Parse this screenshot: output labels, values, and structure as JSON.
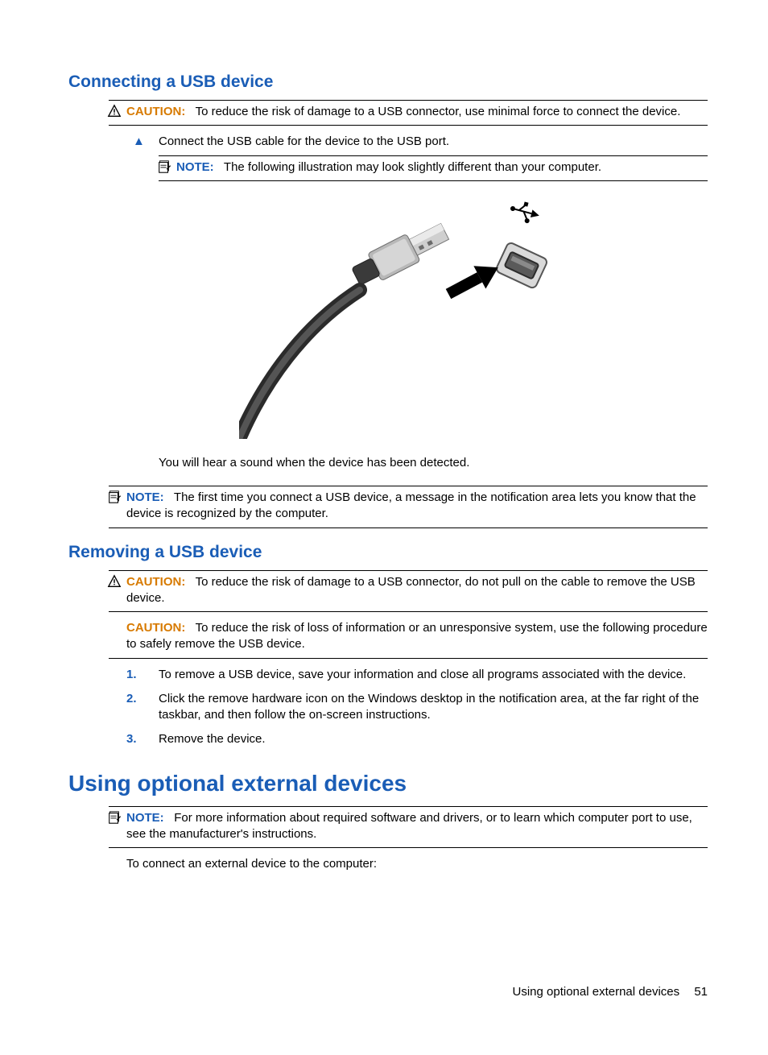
{
  "section1": {
    "title": "Connecting a USB device",
    "caution": {
      "label": "CAUTION:",
      "text": "To reduce the risk of damage to a USB connector, use minimal force to connect the device."
    },
    "step": "Connect the USB cable for the device to the USB port.",
    "note1": {
      "label": "NOTE:",
      "text": "The following illustration may look slightly different than your computer."
    },
    "after_image": "You will hear a sound when the device has been detected.",
    "note2": {
      "label": "NOTE:",
      "text": "The first time you connect a USB device, a message in the notification area lets you know that the device is recognized by the computer."
    }
  },
  "section2": {
    "title": "Removing a USB device",
    "caution1": {
      "label": "CAUTION:",
      "text": "To reduce the risk of damage to a USB connector, do not pull on the cable to remove the USB device."
    },
    "caution2": {
      "label": "CAUTION:",
      "text": "To reduce the risk of loss of information or an unresponsive system, use the following procedure to safely remove the USB device."
    },
    "steps": [
      "To remove a USB device, save your information and close all programs associated with the device.",
      "Click the remove hardware icon on the Windows desktop in the notification area, at the far right of the taskbar, and then follow the on-screen instructions.",
      "Remove the device."
    ]
  },
  "section3": {
    "title": "Using optional external devices",
    "note": {
      "label": "NOTE:",
      "text": "For more information about required software and drivers, or to learn which computer port to use, see the manufacturer's instructions."
    },
    "intro": "To connect an external device to the computer:"
  },
  "footer": {
    "text": "Using optional external devices",
    "page": "51"
  }
}
